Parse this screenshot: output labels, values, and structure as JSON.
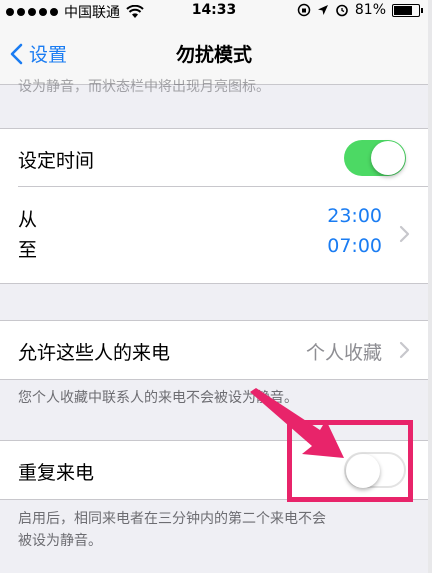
{
  "status_bar": {
    "carrier": "中国联通",
    "time": "14:33",
    "battery": "81%",
    "battery_level": 0.81
  },
  "nav": {
    "back_label": "设置",
    "title": "勿扰模式"
  },
  "truncated_text": "设为静音，而状态栏中将出现月亮图标。",
  "scheduled": {
    "label": "设定时间",
    "enabled": true,
    "from_label": "从",
    "to_label": "至",
    "from_time": "23:00",
    "to_time": "07:00"
  },
  "allow_calls": {
    "label": "允许这些人的来电",
    "value": "个人收藏",
    "footnote": "您个人收藏中联系人的来电不会被设为静音。"
  },
  "repeated_calls": {
    "label": "重复来电",
    "enabled": false,
    "footnote_line1": "启用后，相同来电者在三分钟内的第二个来电不会",
    "footnote_line2": "被设为静音。"
  },
  "colors": {
    "accent": "#1a7cf2",
    "toggle_on": "#4cd964",
    "highlight": "#e8246a"
  }
}
